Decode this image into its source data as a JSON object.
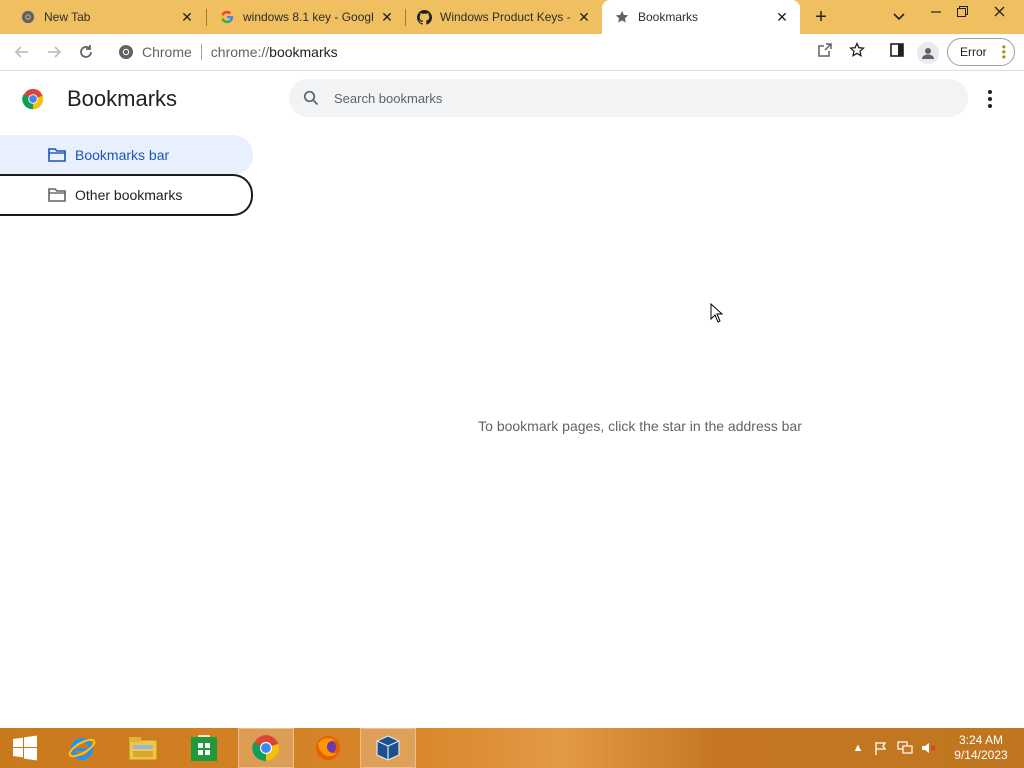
{
  "tabs": [
    {
      "title": "New Tab",
      "icon": "chrome-icon",
      "active": false
    },
    {
      "title": "windows 8.1 key - Googl",
      "icon": "google-icon",
      "active": false
    },
    {
      "title": "Windows Product Keys -",
      "icon": "github-icon",
      "active": false
    },
    {
      "title": "Bookmarks",
      "icon": "star-icon",
      "active": true
    }
  ],
  "toolbar": {
    "origin_chip": "Chrome",
    "url_scheme": "chrome://",
    "url_rest": "bookmarks",
    "error_label": "Error"
  },
  "page": {
    "title": "Bookmarks",
    "search_placeholder": "Search bookmarks",
    "empty_message": "To bookmark pages, click the star in the address bar"
  },
  "sidebar": {
    "items": [
      {
        "label": "Bookmarks bar",
        "selected": true
      },
      {
        "label": "Other bookmarks",
        "selected": false
      }
    ]
  },
  "taskbar": {
    "apps": [
      "start",
      "internet-explorer",
      "file-explorer",
      "store",
      "chrome",
      "firefox",
      "virtualbox"
    ],
    "clock_time": "3:24 AM",
    "clock_date": "9/14/2023"
  },
  "colors": {
    "tabstrip": "#f0c060",
    "accent_blue": "#1a56b8",
    "selected_bg": "#e8f0fe",
    "taskbar": "#c8791b"
  }
}
